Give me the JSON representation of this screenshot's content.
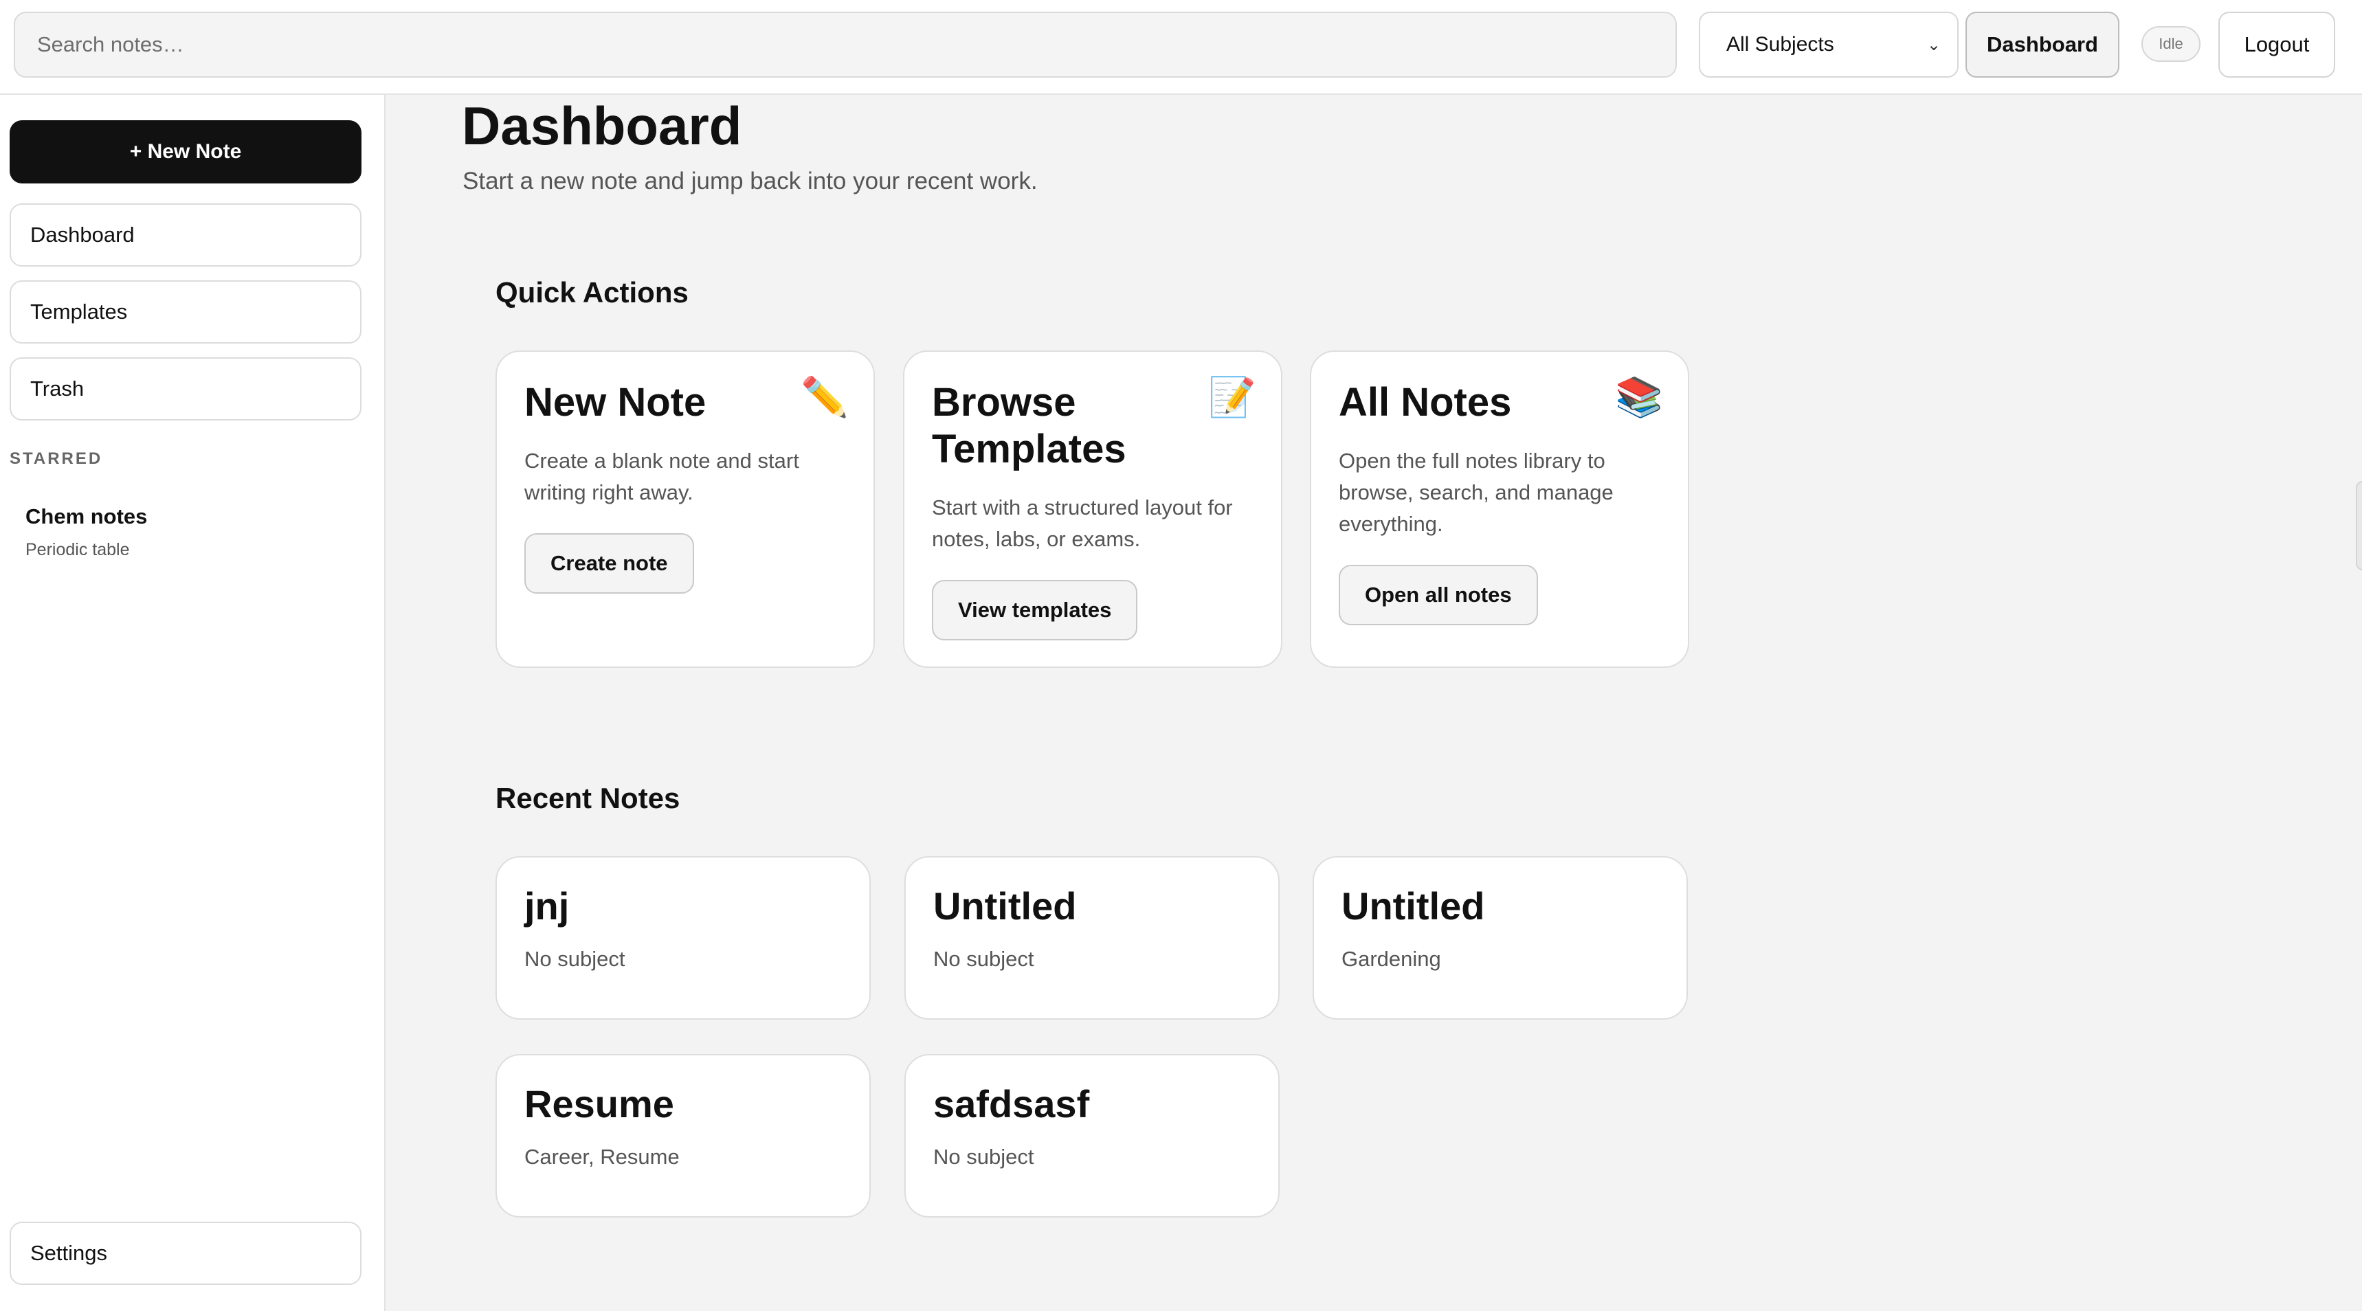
{
  "header": {
    "search_placeholder": "Search notes…",
    "subject_filter": "All Subjects",
    "dashboard_label": "Dashboard",
    "status_badge": "Idle",
    "logout_label": "Logout"
  },
  "sidebar": {
    "new_note_label": "+ New Note",
    "items": [
      {
        "label": "Dashboard"
      },
      {
        "label": "Templates"
      },
      {
        "label": "Trash"
      }
    ],
    "starred_heading": "STARRED",
    "starred": [
      {
        "title": "Chem notes",
        "subtitle": "Periodic table"
      }
    ],
    "settings_label": "Settings"
  },
  "main": {
    "title": "Dashboard",
    "subtitle": "Start a new note and jump back into your recent work.",
    "quick_actions_heading": "Quick Actions",
    "quick_actions": [
      {
        "title": "New Note",
        "icon": "pencil-icon",
        "icon_glyph": "✏️",
        "description": "Create a blank note and start writing right away.",
        "button": "Create note"
      },
      {
        "title": "Browse Templates",
        "icon": "memo-icon",
        "icon_glyph": "📝",
        "description": "Start with a structured layout for notes, labs, or exams.",
        "button": "View templates"
      },
      {
        "title": "All Notes",
        "icon": "books-icon",
        "icon_glyph": "📚",
        "description": "Open the full notes library to browse, search, and manage everything.",
        "button": "Open all notes"
      }
    ],
    "recent_heading": "Recent Notes",
    "recent_notes": [
      {
        "title": "jnj",
        "subject": "No subject"
      },
      {
        "title": "Untitled",
        "subject": "No subject"
      },
      {
        "title": "Untitled",
        "subject": "Gardening"
      },
      {
        "title": "Resume",
        "subject": "Career, Resume"
      },
      {
        "title": "safdsasf",
        "subject": "No subject"
      }
    ]
  }
}
